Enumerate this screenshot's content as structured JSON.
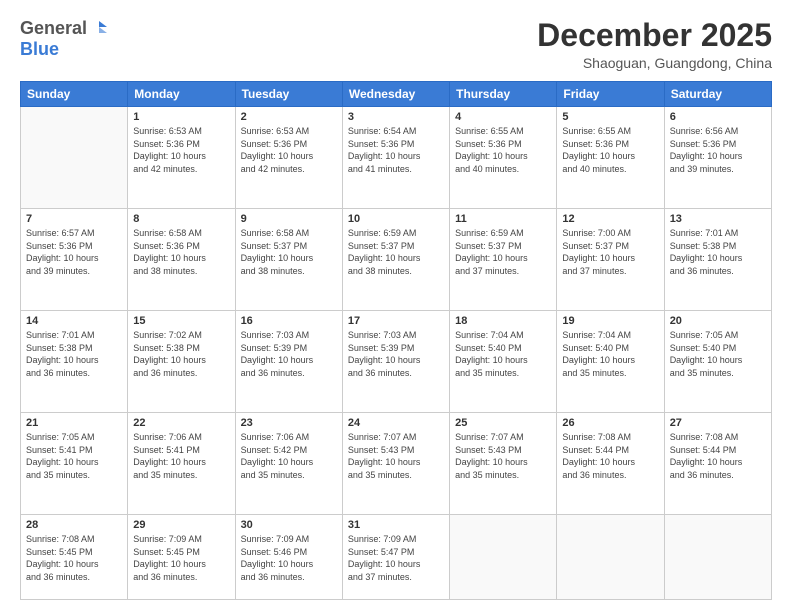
{
  "header": {
    "logo_general": "General",
    "logo_blue": "Blue",
    "month": "December 2025",
    "location": "Shaoguan, Guangdong, China"
  },
  "days_of_week": [
    "Sunday",
    "Monday",
    "Tuesday",
    "Wednesday",
    "Thursday",
    "Friday",
    "Saturday"
  ],
  "weeks": [
    [
      {
        "day": "",
        "info": ""
      },
      {
        "day": "1",
        "info": "Sunrise: 6:53 AM\nSunset: 5:36 PM\nDaylight: 10 hours\nand 42 minutes."
      },
      {
        "day": "2",
        "info": "Sunrise: 6:53 AM\nSunset: 5:36 PM\nDaylight: 10 hours\nand 42 minutes."
      },
      {
        "day": "3",
        "info": "Sunrise: 6:54 AM\nSunset: 5:36 PM\nDaylight: 10 hours\nand 41 minutes."
      },
      {
        "day": "4",
        "info": "Sunrise: 6:55 AM\nSunset: 5:36 PM\nDaylight: 10 hours\nand 40 minutes."
      },
      {
        "day": "5",
        "info": "Sunrise: 6:55 AM\nSunset: 5:36 PM\nDaylight: 10 hours\nand 40 minutes."
      },
      {
        "day": "6",
        "info": "Sunrise: 6:56 AM\nSunset: 5:36 PM\nDaylight: 10 hours\nand 39 minutes."
      }
    ],
    [
      {
        "day": "7",
        "info": "Sunrise: 6:57 AM\nSunset: 5:36 PM\nDaylight: 10 hours\nand 39 minutes."
      },
      {
        "day": "8",
        "info": "Sunrise: 6:58 AM\nSunset: 5:36 PM\nDaylight: 10 hours\nand 38 minutes."
      },
      {
        "day": "9",
        "info": "Sunrise: 6:58 AM\nSunset: 5:37 PM\nDaylight: 10 hours\nand 38 minutes."
      },
      {
        "day": "10",
        "info": "Sunrise: 6:59 AM\nSunset: 5:37 PM\nDaylight: 10 hours\nand 38 minutes."
      },
      {
        "day": "11",
        "info": "Sunrise: 6:59 AM\nSunset: 5:37 PM\nDaylight: 10 hours\nand 37 minutes."
      },
      {
        "day": "12",
        "info": "Sunrise: 7:00 AM\nSunset: 5:37 PM\nDaylight: 10 hours\nand 37 minutes."
      },
      {
        "day": "13",
        "info": "Sunrise: 7:01 AM\nSunset: 5:38 PM\nDaylight: 10 hours\nand 36 minutes."
      }
    ],
    [
      {
        "day": "14",
        "info": "Sunrise: 7:01 AM\nSunset: 5:38 PM\nDaylight: 10 hours\nand 36 minutes."
      },
      {
        "day": "15",
        "info": "Sunrise: 7:02 AM\nSunset: 5:38 PM\nDaylight: 10 hours\nand 36 minutes."
      },
      {
        "day": "16",
        "info": "Sunrise: 7:03 AM\nSunset: 5:39 PM\nDaylight: 10 hours\nand 36 minutes."
      },
      {
        "day": "17",
        "info": "Sunrise: 7:03 AM\nSunset: 5:39 PM\nDaylight: 10 hours\nand 36 minutes."
      },
      {
        "day": "18",
        "info": "Sunrise: 7:04 AM\nSunset: 5:40 PM\nDaylight: 10 hours\nand 35 minutes."
      },
      {
        "day": "19",
        "info": "Sunrise: 7:04 AM\nSunset: 5:40 PM\nDaylight: 10 hours\nand 35 minutes."
      },
      {
        "day": "20",
        "info": "Sunrise: 7:05 AM\nSunset: 5:40 PM\nDaylight: 10 hours\nand 35 minutes."
      }
    ],
    [
      {
        "day": "21",
        "info": "Sunrise: 7:05 AM\nSunset: 5:41 PM\nDaylight: 10 hours\nand 35 minutes."
      },
      {
        "day": "22",
        "info": "Sunrise: 7:06 AM\nSunset: 5:41 PM\nDaylight: 10 hours\nand 35 minutes."
      },
      {
        "day": "23",
        "info": "Sunrise: 7:06 AM\nSunset: 5:42 PM\nDaylight: 10 hours\nand 35 minutes."
      },
      {
        "day": "24",
        "info": "Sunrise: 7:07 AM\nSunset: 5:43 PM\nDaylight: 10 hours\nand 35 minutes."
      },
      {
        "day": "25",
        "info": "Sunrise: 7:07 AM\nSunset: 5:43 PM\nDaylight: 10 hours\nand 35 minutes."
      },
      {
        "day": "26",
        "info": "Sunrise: 7:08 AM\nSunset: 5:44 PM\nDaylight: 10 hours\nand 36 minutes."
      },
      {
        "day": "27",
        "info": "Sunrise: 7:08 AM\nSunset: 5:44 PM\nDaylight: 10 hours\nand 36 minutes."
      }
    ],
    [
      {
        "day": "28",
        "info": "Sunrise: 7:08 AM\nSunset: 5:45 PM\nDaylight: 10 hours\nand 36 minutes."
      },
      {
        "day": "29",
        "info": "Sunrise: 7:09 AM\nSunset: 5:45 PM\nDaylight: 10 hours\nand 36 minutes."
      },
      {
        "day": "30",
        "info": "Sunrise: 7:09 AM\nSunset: 5:46 PM\nDaylight: 10 hours\nand 36 minutes."
      },
      {
        "day": "31",
        "info": "Sunrise: 7:09 AM\nSunset: 5:47 PM\nDaylight: 10 hours\nand 37 minutes."
      },
      {
        "day": "",
        "info": ""
      },
      {
        "day": "",
        "info": ""
      },
      {
        "day": "",
        "info": ""
      }
    ]
  ]
}
